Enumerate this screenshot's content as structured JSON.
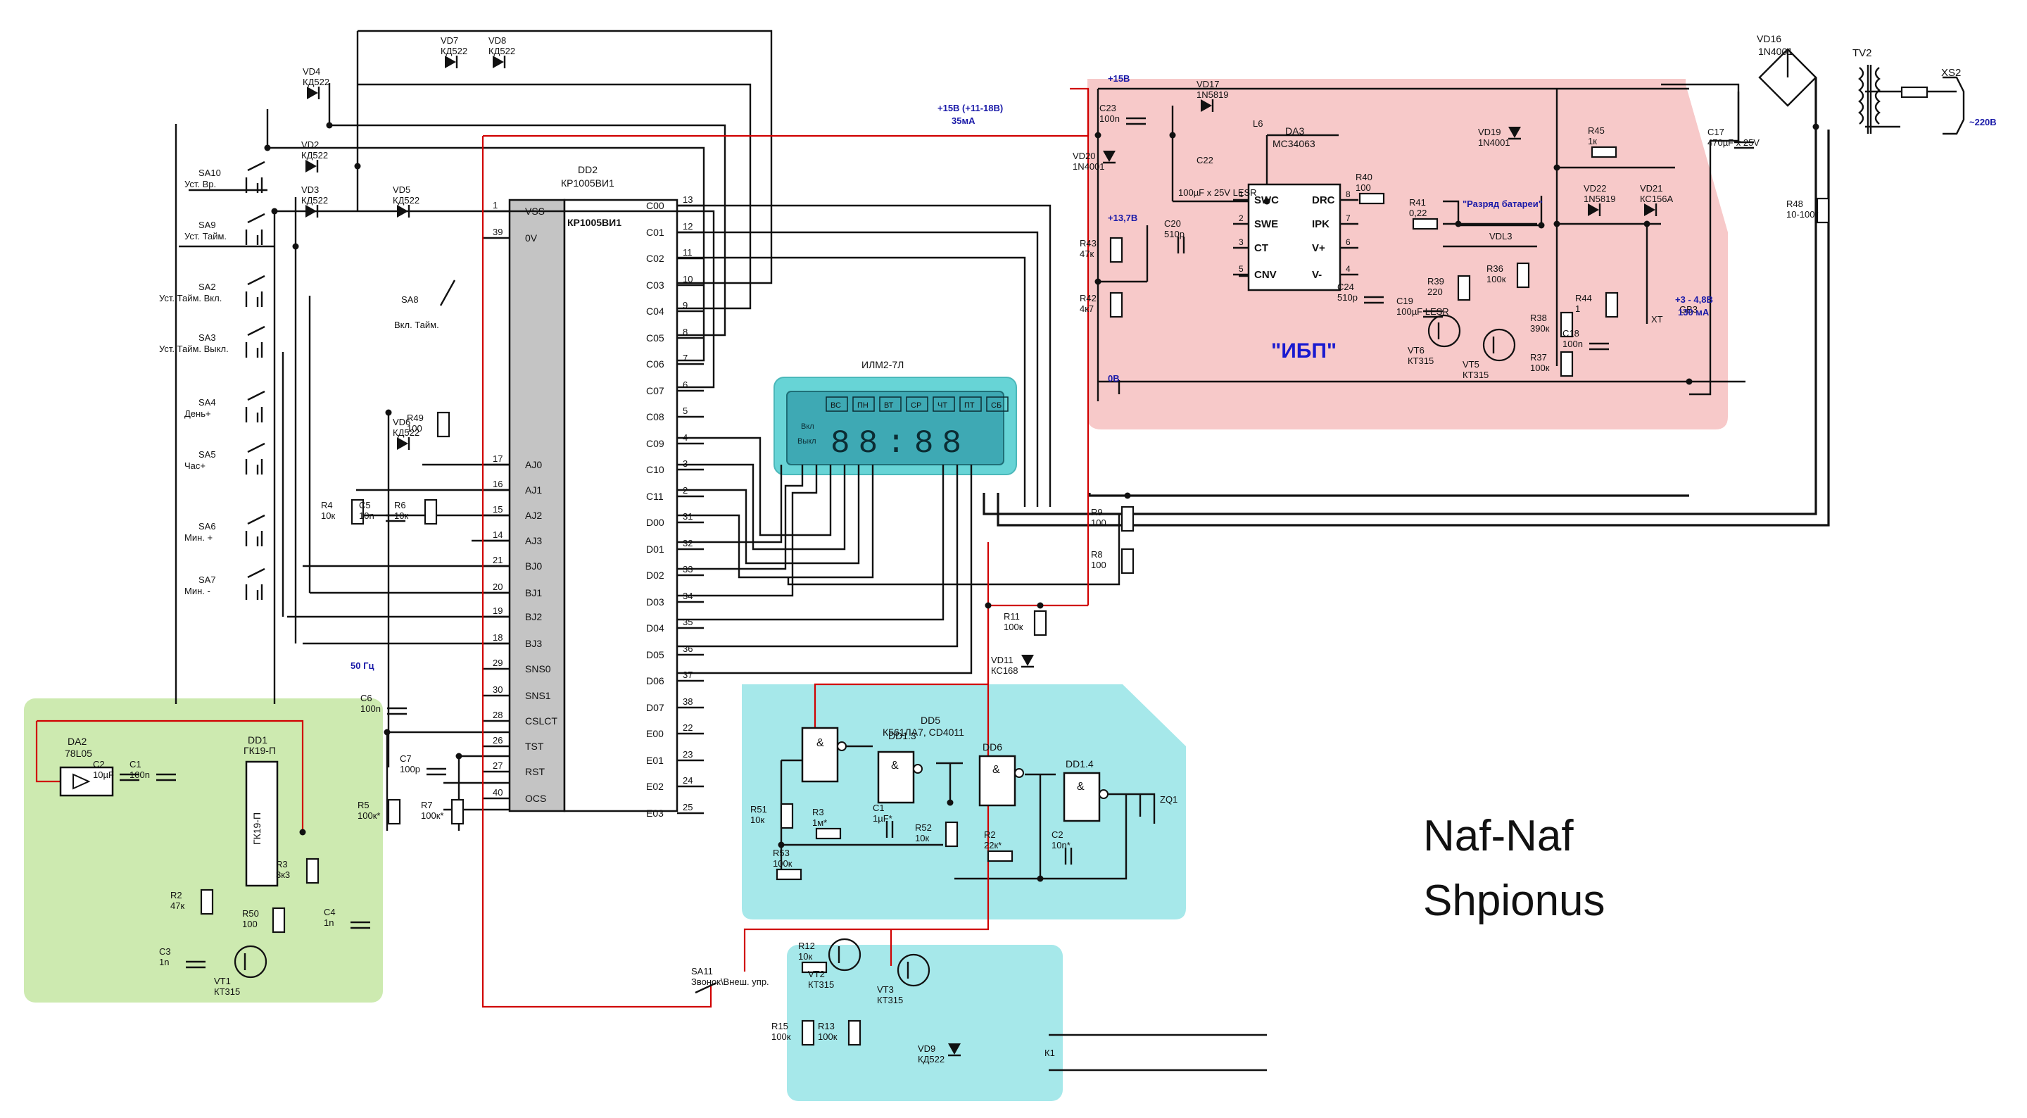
{
  "signature": {
    "line1": "Naf-Naf",
    "line2": "Shpionus"
  },
  "regions": {
    "ups_label": "\"ИБП\"",
    "power_plus15": "+15В",
    "power_137": "+13,7В",
    "power_0": "0В",
    "supply_note_1": "+15В (+11-18В)",
    "supply_note_2": "35мА",
    "battery_note": "\"Разряд батареи\"",
    "battery_range_1": "+3 - 4,8В",
    "battery_range_2": "130 мА",
    "freq_50hz": "50 Гц",
    "mains": "~220В"
  },
  "dd2": {
    "name": "DD2",
    "part": "КР1005ВИ1",
    "left_pins": [
      {
        "num": "1",
        "name": "VSS"
      },
      {
        "num": "39",
        "name": "0V"
      },
      {
        "num": "17",
        "name": "AJ0"
      },
      {
        "num": "16",
        "name": "AJ1"
      },
      {
        "num": "15",
        "name": "AJ2"
      },
      {
        "num": "14",
        "name": "AJ3"
      },
      {
        "num": "21",
        "name": "BJ0"
      },
      {
        "num": "20",
        "name": "BJ1"
      },
      {
        "num": "19",
        "name": "BJ2"
      },
      {
        "num": "18",
        "name": "BJ3"
      },
      {
        "num": "29",
        "name": "SNS0"
      },
      {
        "num": "30",
        "name": "SNS1"
      },
      {
        "num": "28",
        "name": "CSLCT"
      },
      {
        "num": "26",
        "name": "TST"
      },
      {
        "num": "27",
        "name": "RST"
      },
      {
        "num": "40",
        "name": "OCS"
      }
    ],
    "right_pins": [
      {
        "num": "13",
        "name": "C00"
      },
      {
        "num": "12",
        "name": "C01"
      },
      {
        "num": "11",
        "name": "C02"
      },
      {
        "num": "10",
        "name": "C03"
      },
      {
        "num": "9",
        "name": "C04"
      },
      {
        "num": "8",
        "name": "C05"
      },
      {
        "num": "7",
        "name": "C06"
      },
      {
        "num": "6",
        "name": "C07"
      },
      {
        "num": "5",
        "name": "C08"
      },
      {
        "num": "4",
        "name": "C09"
      },
      {
        "num": "3",
        "name": "C10"
      },
      {
        "num": "2",
        "name": "C11"
      },
      {
        "num": "31",
        "name": "D00"
      },
      {
        "num": "32",
        "name": "D01"
      },
      {
        "num": "33",
        "name": "D02"
      },
      {
        "num": "34",
        "name": "D03"
      },
      {
        "num": "35",
        "name": "D04"
      },
      {
        "num": "36",
        "name": "D05"
      },
      {
        "num": "37",
        "name": "D06"
      },
      {
        "num": "38",
        "name": "D07"
      },
      {
        "num": "22",
        "name": "E00"
      },
      {
        "num": "23",
        "name": "E01"
      },
      {
        "num": "24",
        "name": "E02"
      },
      {
        "num": "25",
        "name": "E03"
      }
    ]
  },
  "display": {
    "name": "ИЛМ2-7Л",
    "days": [
      "ВС",
      "ПН",
      "ВТ",
      "СР",
      "ЧТ",
      "ПТ",
      "СБ"
    ],
    "side": [
      "Вкл",
      "Выкл"
    ],
    "digits": "88:88"
  },
  "dd3": {
    "name": "DA3",
    "part": "MC34063",
    "left_pins": [
      {
        "num": "1",
        "name": "SWC"
      },
      {
        "num": "2",
        "name": "SWE"
      },
      {
        "num": "3",
        "name": "CT"
      },
      {
        "num": "5",
        "name": "CNV"
      }
    ],
    "right_pins": [
      {
        "num": "8",
        "name": "DRC"
      },
      {
        "num": "7",
        "name": "IPK"
      },
      {
        "num": "6",
        "name": "V+"
      },
      {
        "num": "4",
        "name": "V-"
      }
    ]
  },
  "switches": [
    {
      "ref": "SA10",
      "label": "Уст. Вр."
    },
    {
      "ref": "SA9",
      "label": "Уст. Тайм."
    },
    {
      "ref": "SA2",
      "label": "Уст. Тайм. Вкл."
    },
    {
      "ref": "SA3",
      "label": "Уст. Тайм. Выкл."
    },
    {
      "ref": "SA4",
      "label": "День+"
    },
    {
      "ref": "SA5",
      "label": "Час+"
    },
    {
      "ref": "SA6",
      "label": "Мин. +"
    },
    {
      "ref": "SA7",
      "label": "Мин. -"
    }
  ],
  "parts": {
    "vd7": [
      "VD7",
      "КД522"
    ],
    "vd8": [
      "VD8",
      "КД522"
    ],
    "vd4": [
      "VD4",
      "КД522"
    ],
    "vd2": [
      "VD2",
      "КД522"
    ],
    "vd3": [
      "VD3",
      "КД522"
    ],
    "vd5": [
      "VD5",
      "КД522"
    ],
    "vd6": [
      "VD6",
      "КД522"
    ],
    "sa8": [
      "SA8",
      "Вкл. Тайм."
    ],
    "r49": [
      "R49",
      "100"
    ],
    "r4": [
      "R4",
      "10к"
    ],
    "c5": [
      "C5",
      "10n"
    ],
    "r6": [
      "R6",
      "10к"
    ],
    "c6": [
      "C6",
      "100n"
    ],
    "c7": [
      "C7",
      "100p"
    ],
    "r5": [
      "R5",
      "100к*"
    ],
    "r7": [
      "R7",
      "100к*"
    ],
    "da2": [
      "DA2",
      "78L05"
    ],
    "c2": [
      "C2",
      "10µF"
    ],
    "c1": [
      "C1",
      "100n"
    ],
    "dd1": [
      "DD1",
      "ГК19-П"
    ],
    "r3": [
      "R3",
      "3к3"
    ],
    "r2": [
      "R2",
      "47к"
    ],
    "r50": [
      "R50",
      "100"
    ],
    "c3": [
      "C3",
      "1n"
    ],
    "c4": [
      "C4",
      "1n"
    ],
    "vt1": [
      "VT1",
      "КТ315"
    ],
    "dd5": [
      "DD5",
      "К561ЛА7, CD4011"
    ],
    "dd13": "DD1.3",
    "dd6": "DD6",
    "dd14": "DD1.4",
    "r51": [
      "R51",
      "10к"
    ],
    "r3b": [
      "R3",
      "1м*"
    ],
    "c1b": [
      "C1",
      "1µF*"
    ],
    "r52": [
      "R52",
      "10к"
    ],
    "r2b": [
      "R2",
      "22к*"
    ],
    "c2b": [
      "C2",
      "10n*"
    ],
    "r53": [
      "R53",
      "100к"
    ],
    "zq1": "ZQ1",
    "sa11": [
      "SA11",
      "Звонок\\Внеш. упр."
    ],
    "r12": [
      "R12",
      "10к"
    ],
    "vt2": [
      "VT2",
      "КТ315"
    ],
    "vt3": [
      "VT3",
      "КТ315"
    ],
    "r15": [
      "R15",
      "100к"
    ],
    "r13": [
      "R13",
      "100к"
    ],
    "vd9": [
      "VD9",
      "КД522"
    ],
    "k1": "К1",
    "r9": [
      "R9",
      "100"
    ],
    "r8": [
      "R8",
      "100"
    ],
    "r11": [
      "R11",
      "100к"
    ],
    "vd11": [
      "VD11",
      "КС168"
    ],
    "c23": [
      "C23",
      "100n"
    ],
    "vd17": [
      "VD17",
      "1N5819"
    ],
    "l6": "L6",
    "c22": "100µF x 25V LESR",
    "c22ref": "C22",
    "vd20": [
      "VD20",
      "1N4001"
    ],
    "r43": [
      "R43",
      "47к"
    ],
    "r42": [
      "R42",
      "4к7"
    ],
    "c20": [
      "C20",
      "510p"
    ],
    "r40": [
      "R40",
      "100"
    ],
    "r41": [
      "R41",
      "0,22"
    ],
    "c24": [
      "C24",
      "510p"
    ],
    "c19": [
      "C19",
      "100µF LESR"
    ],
    "vdl3": "VDL3",
    "r39": [
      "R39",
      "220"
    ],
    "r36": [
      "R36",
      "100к"
    ],
    "vt6": [
      "VT6",
      "КТ315"
    ],
    "vt5": [
      "VT5",
      "КТ315"
    ],
    "r38": [
      "R38",
      "390к"
    ],
    "r37": [
      "R37",
      "100к"
    ],
    "vd19": [
      "VD19",
      "1N4001"
    ],
    "r45": [
      "R45",
      "1к"
    ],
    "vd22": [
      "VD22",
      "1N5819"
    ],
    "vd21": [
      "VD21",
      "КС156А"
    ],
    "r44": [
      "R44",
      "1"
    ],
    "c18": [
      "C18",
      "100n"
    ],
    "xt": "XT",
    "gb3": "GB3",
    "c17": [
      "C17",
      "470µF x 25V"
    ],
    "r48": [
      "R48",
      "10-100*"
    ],
    "vd16": [
      "VD16",
      "1N4001"
    ],
    "tv2": "TV2",
    "xs2": "XS2"
  }
}
